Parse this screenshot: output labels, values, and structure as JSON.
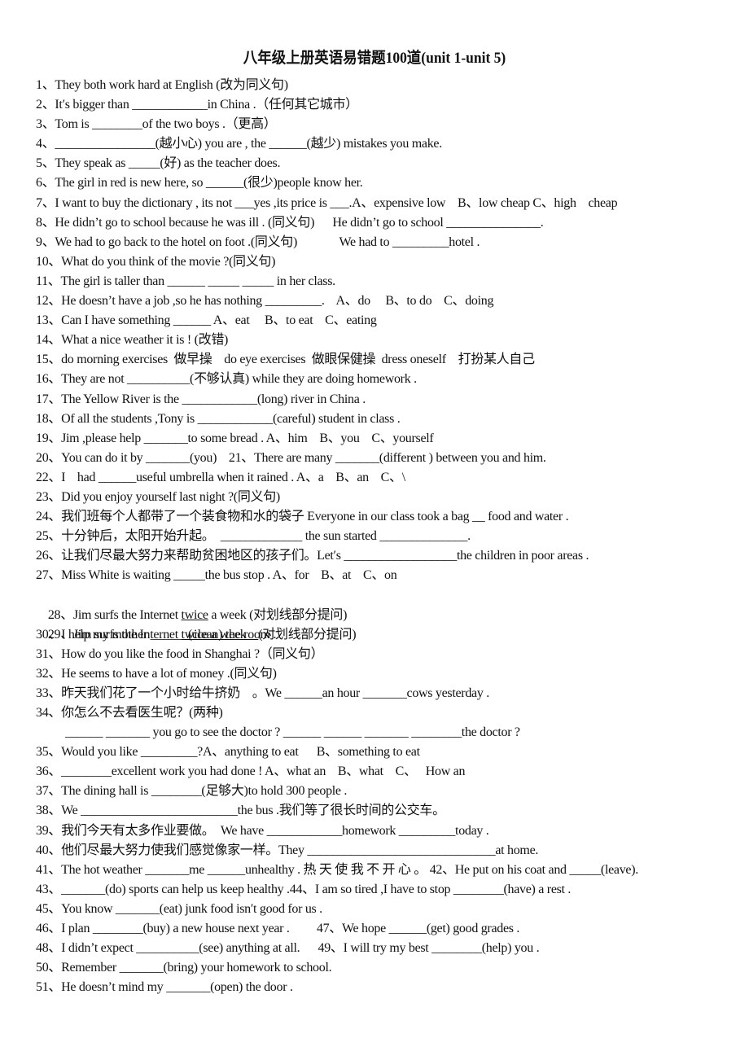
{
  "title": "八年级上册英语易错题100道(unit 1-unit 5)",
  "questions": [
    "1、They both work hard at English (改为同义句)",
    "2、It′s bigger than ____________in China .（任何其它城市）",
    "3、Tom is ________of the two boys .（更高）",
    "4、________________(越小心) you are , the ______(越少) mistakes you make.",
    "5、They speak as _____(好) as the teacher does.",
    "6、The girl in red is new here, so ______(很少)people know her.",
    "7、I want to buy the dictionary , its not ___yes ,its price is ___.A、expensive low    B、low cheap C、high    cheap",
    "8、He didn’t go to school because he was ill . (同义句)      He didn’t go to school _______________.",
    "9、We had to go back to the hotel on foot .(同义句)              We had to _________hotel .",
    "10、What do you think of the movie ?(同义句)",
    "11、The girl is taller than ______ _____ _____ in her class.",
    "12、He doesn’t have a job ,so he has nothing _________.    A、do     B、to do    C、doing",
    "13、Can I have something ______ A、eat     B、to eat    C、eating",
    "14、What a nice weather it is ! (改错)",
    "15、do morning exercises  做早操    do eye exercises  做眼保健操  dress oneself    打扮某人自己",
    "16、They are not __________(不够认真) while they are doing homework .",
    "17、The Yellow River is the ____________(long) river in China .",
    "18、Of all the students ,Tony is ____________(careful) student in class .",
    "19、Jim ,please help _______to some bread . A、him    B、you    C、yourself",
    "20、You can do it by _______(you)    21、There are many _______(different ) between you and him.",
    "22、I    had ______useful umbrella when it rained . A、a    B、an    C、\\",
    "23、Did you enjoy yourself last night ?(同义句)",
    "24、我们班每个人都带了一个装食物和水的袋子 Everyone in our class took a bag __ food and water .",
    "25、十分钟后，太阳开始升起。  _____________ the sun started ______________.",
    "26、让我们尽最大努力来帮助贫困地区的孩子们。Let′s __________________the children in poor areas .",
    "27、Miss White is waiting _____the bus stop . A、for    B、at    C、on",
    {
      "pre": "28、Jim surfs the Internet ",
      "underlined": "twice",
      "post": " a week (对划线部分提问)"
    },
    {
      "pre": "29、Jim surfs the Internet ",
      "underlined": "twice a week    ",
      "post": "(对划线部分提问)"
    },
    "30、I help my mother ______(clean) the room .",
    "31、How do you like the food in Shanghai ?（同义句）",
    "32、He seems to have a lot of money .(同义句)",
    "33、昨天我们花了一个小时给牛挤奶    。We ______an hour _______cows yesterday .",
    "34、你怎么不去看医生呢？(两种)",
    "______ _______ you go to see the doctor ? ______ ______ _______ ________the doctor ?",
    "35、Would you like _________?A、anything to eat      B、something to eat",
    "36、________excellent work you had done ! A、what an    B、what    C、   How an",
    "37、The dining hall is ________(足够大)to hold 300 people .",
    "38、We _________________________the bus .我们等了很长时间的公交车。",
    "39、我们今天有太多作业要做。  We have ____________homework _________today .",
    "40、他们尽最大努力使我们感觉像家一样。They ______________________________at home.",
    "41、The hot weather _______me ______unhealthy . 热 天 使 我 不 开 心 。 42、He put on his coat and _____(leave).",
    "43、_______(do) sports can help us keep healthy .44、I am so tired ,I have to stop ________(have) a rest .",
    "45、You know _______(eat) junk food isn′t good for us .",
    "46、I plan ________(buy) a new house next year .         47、We hope ______(get) good grades .",
    "48、I didn’t expect __________(see) anything at all.      49、I will try my best ________(help) you .",
    "50、Remember _______(bring) your homework to school.",
    "51、He doesn’t mind my _______(open) the door ."
  ]
}
